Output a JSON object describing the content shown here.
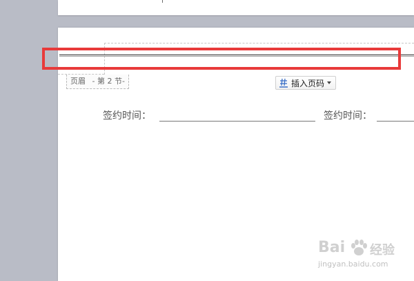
{
  "header": {
    "label_name": "页眉",
    "label_section": "- 第 2 节-"
  },
  "toolbar": {
    "insert_page_number_label": "插入页码",
    "insert_page_number_icon": "page-number-hash-icon"
  },
  "document": {
    "sign_label_1": "签约时间：",
    "sign_label_2": "签约时间："
  },
  "watermark": {
    "brand_left": "Bai",
    "brand_right": "经验",
    "url": "jingyan.baidu.com"
  },
  "colors": {
    "workspace": "#b9bcc6",
    "page": "#ffffff",
    "highlight": "#e83a3a",
    "rule": "#2a2a2a"
  }
}
